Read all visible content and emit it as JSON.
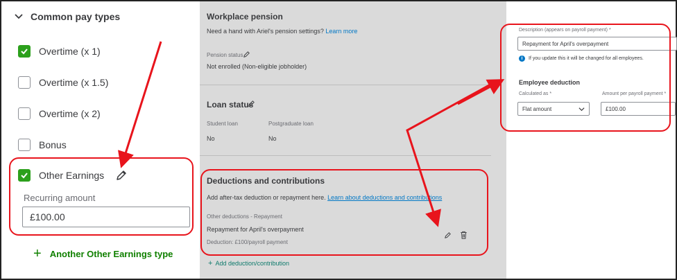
{
  "left": {
    "section_title": "Common pay types",
    "pay_types": [
      {
        "label": "Overtime (x 1)",
        "checked": true
      },
      {
        "label": "Overtime (x 1.5)",
        "checked": false
      },
      {
        "label": "Overtime (x 2)",
        "checked": false
      },
      {
        "label": "Bonus",
        "checked": false
      },
      {
        "label": "Other Earnings",
        "checked": true
      }
    ],
    "recurring_label": "Recurring amount",
    "recurring_value": "£100.00",
    "another_label": "Another Other Earnings type"
  },
  "middle": {
    "pension_title": "Workplace pension",
    "pension_help": "Need a hand with Ariel's pension settings?",
    "pension_help_link": "Learn more",
    "pension_status_label": "Pension status",
    "pension_status_value": "Not enrolled (Non-eligible jobholder)",
    "loan_title": "Loan status",
    "student_loan_label": "Student loan",
    "student_loan_value": "No",
    "postgrad_loan_label": "Postgraduate loan",
    "postgrad_loan_value": "No",
    "deductions_title": "Deductions and contributions",
    "deductions_help": "Add after-tax deduction or repayment here.",
    "deductions_help_link": "Learn about deductions and contributions",
    "deduction_category": "Other deductions - Repayment",
    "deduction_name": "Repayment for April's overpayment",
    "deduction_detail": "Deduction: £100/payroll payment",
    "add_link": "Add deduction/contribution"
  },
  "right": {
    "description_label": "Description (appears on payroll payment) *",
    "description_value": "Repayment for April's overpayment",
    "info_text": "If you update this it will be changed for all employees.",
    "employee_deduction_title": "Employee deduction",
    "calculated_as_label": "Calculated as *",
    "calculated_as_value": "Flat amount",
    "amount_label": "Amount per payroll payment *",
    "amount_value": "£100.00"
  },
  "colors": {
    "accent_green": "#2ca01c",
    "link_blue": "#0077c5",
    "annotation_red": "#e8141c"
  }
}
